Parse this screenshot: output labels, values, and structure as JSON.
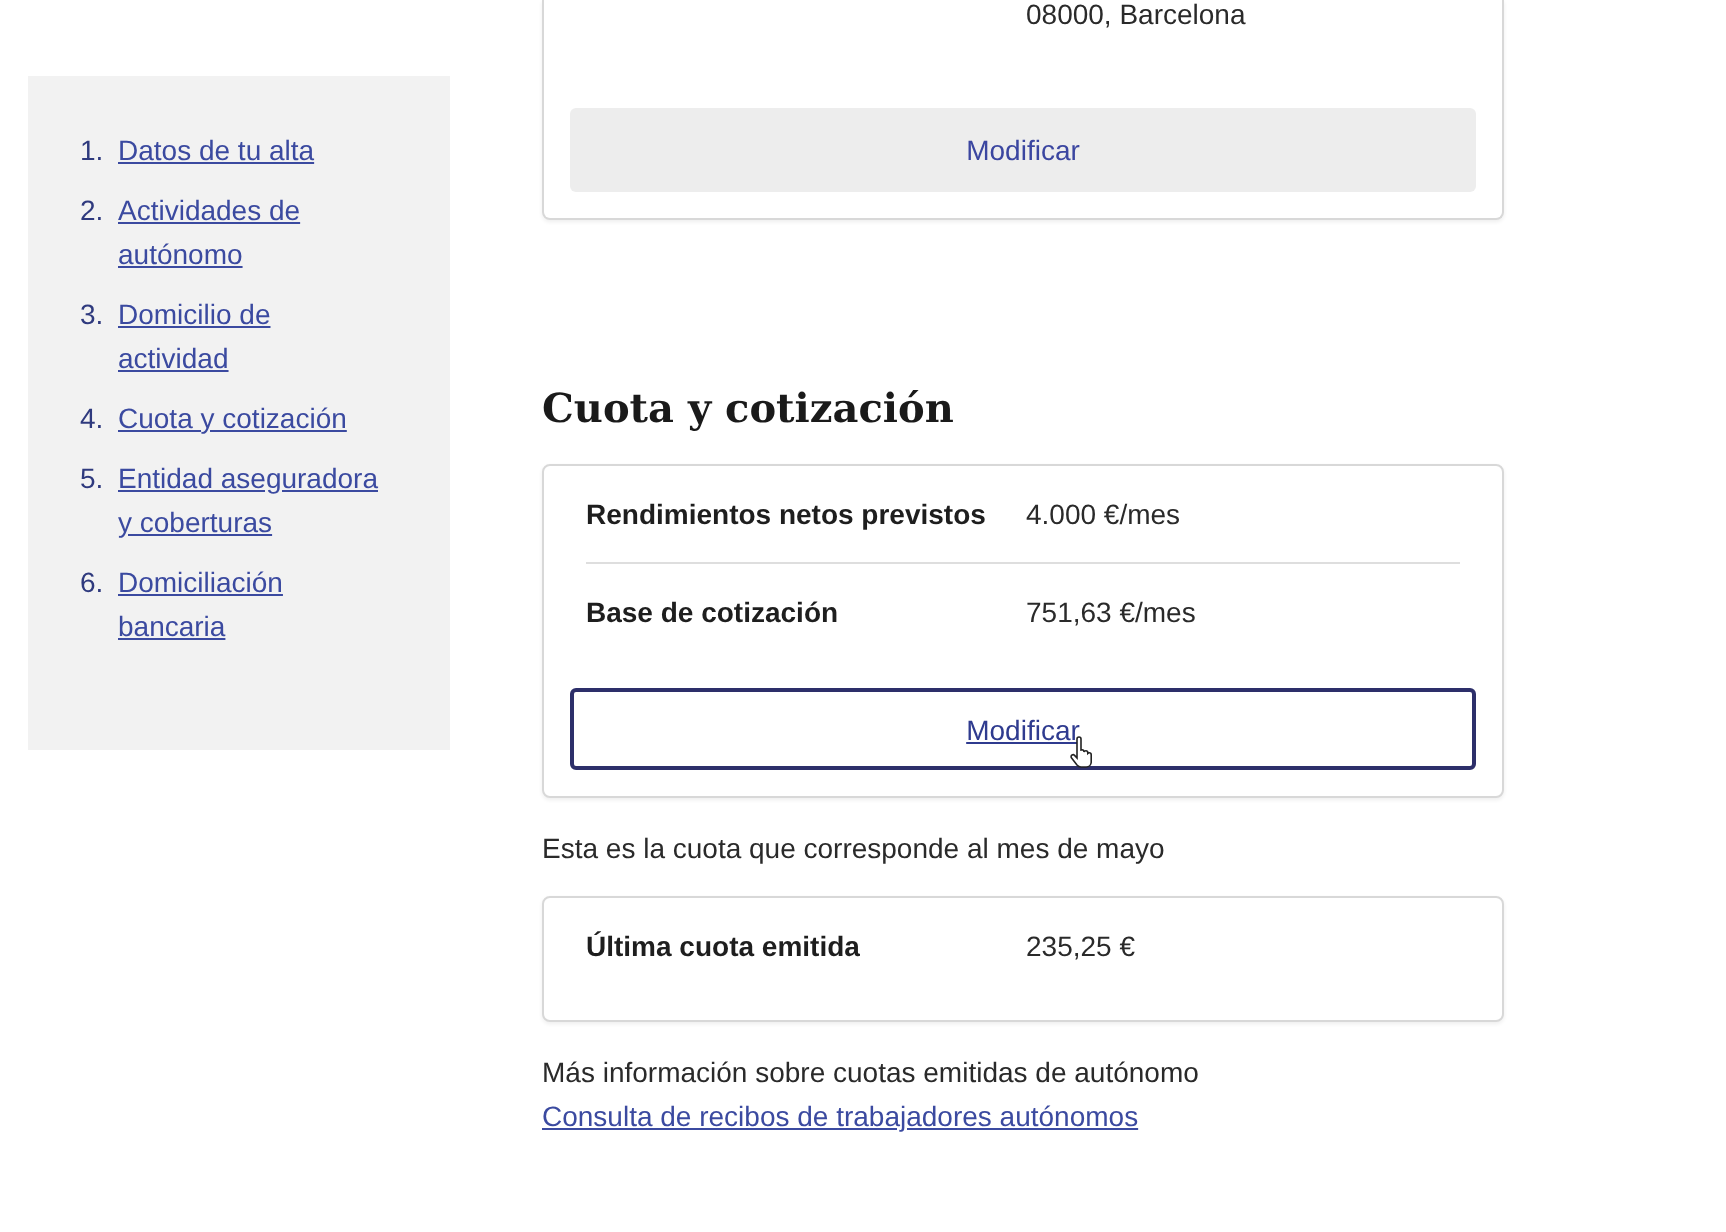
{
  "sidebar": {
    "items": [
      {
        "number": "1.",
        "label": "Datos de tu alta"
      },
      {
        "number": "2.",
        "label": "Actividades de autónomo"
      },
      {
        "number": "3.",
        "label": "Domicilio de actividad"
      },
      {
        "number": "4.",
        "label": "Cuota y cotización"
      },
      {
        "number": "5.",
        "label": "Entidad aseguradora y coberturas"
      },
      {
        "number": "6.",
        "label": "Domiciliación bancaria"
      }
    ]
  },
  "top_card": {
    "rows": [
      {
        "value": "08000, Barcelona"
      }
    ],
    "button": {
      "label": "Modificar",
      "hovered": false
    }
  },
  "section": {
    "title": "Cuota y cotización",
    "card": {
      "rows": [
        {
          "label": "Rendimientos netos previstos",
          "value": "4.000 €/mes"
        },
        {
          "label": "Base de cotización",
          "value": "751,63 €/mes"
        }
      ],
      "button": {
        "label": "Modificar",
        "hovered": true
      }
    },
    "note": "Esta es la cuota que corresponde al mes de mayo",
    "last_fee": {
      "rows": [
        {
          "label": "Última cuota emitida",
          "value": "235,25 €"
        }
      ]
    },
    "more_info": {
      "text": "Más información sobre cuotas emitidas de autónomo",
      "link": "Consulta de recibos de trabajadores autónomos"
    }
  }
}
